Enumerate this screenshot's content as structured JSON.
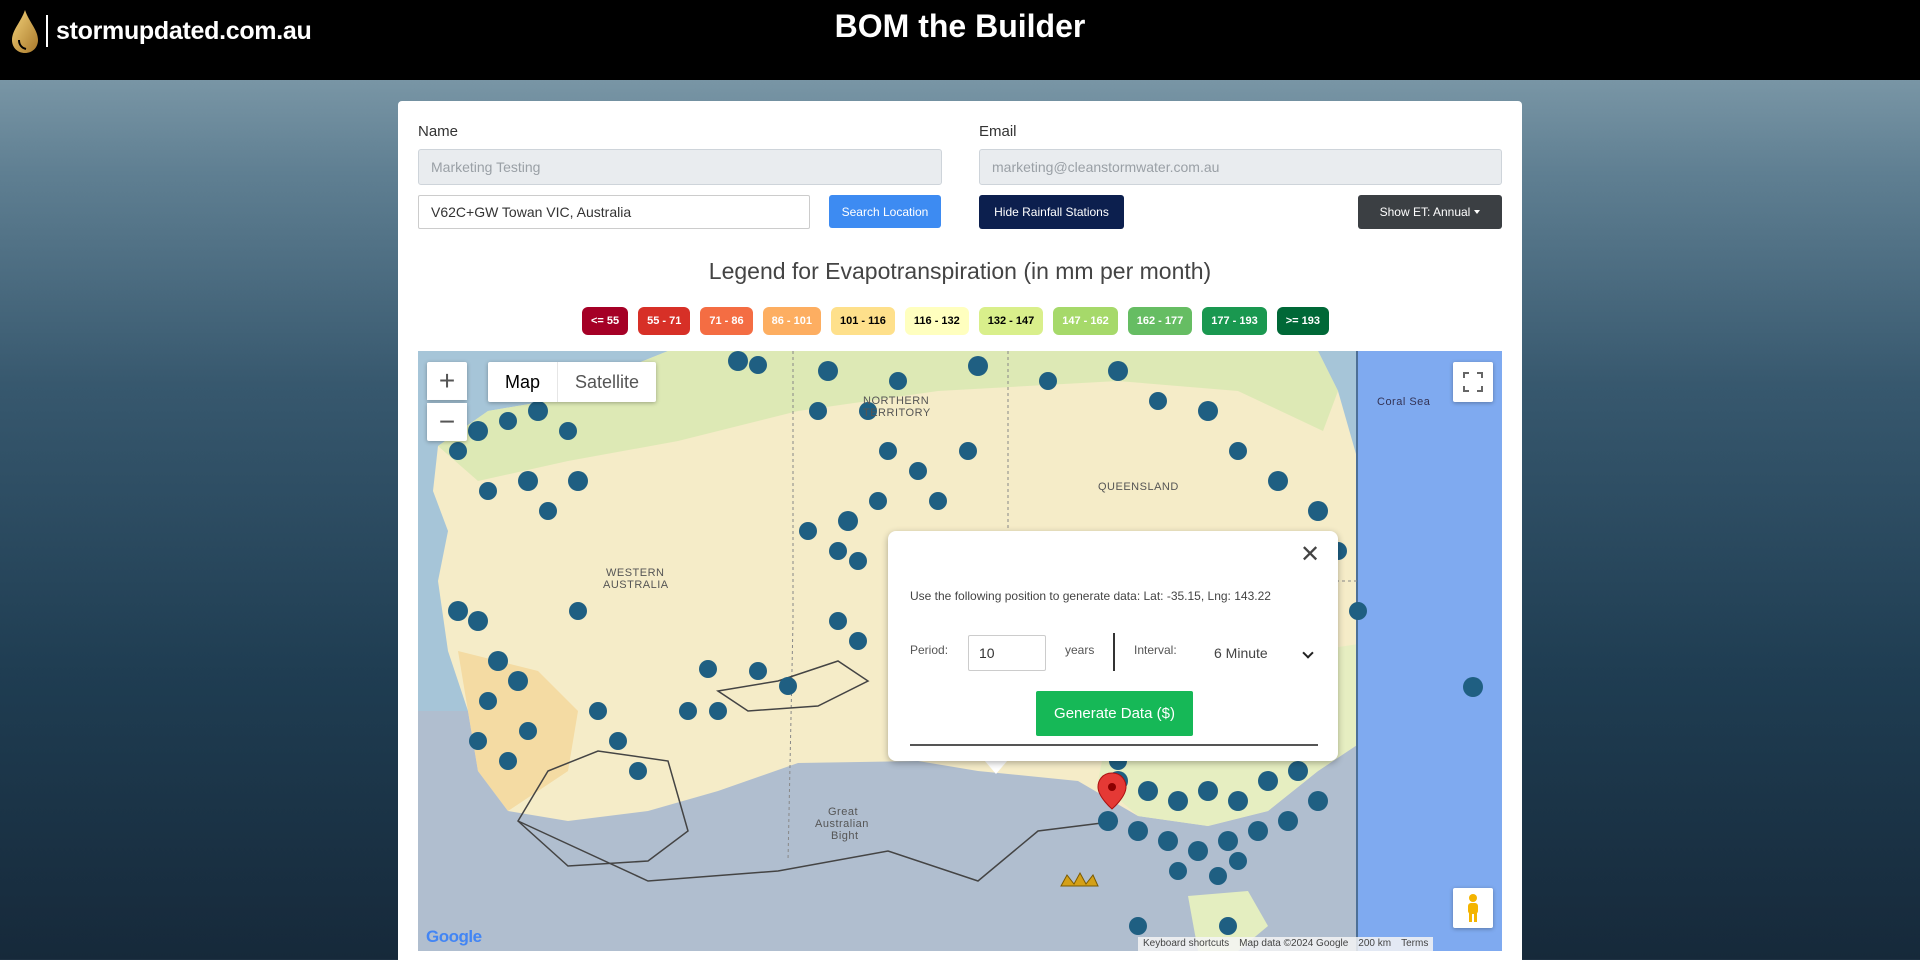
{
  "header": {
    "site_name": "stormupdated.com.au",
    "title": "BOM the Builder"
  },
  "form": {
    "name_label": "Name",
    "name_value": "Marketing Testing",
    "email_label": "Email",
    "email_value": "marketing@cleanstormwater.com.au",
    "location_value": "V62C+GW Towan VIC, Australia",
    "search_button": "Search Location",
    "hide_stations_button": "Hide Rainfall Stations",
    "show_et_button": "Show ET: Annual"
  },
  "legend": {
    "title": "Legend for Evapotranspiration (in mm per month)",
    "items": [
      {
        "label": "<= 55",
        "color": "#a50026",
        "text": "#ffffff"
      },
      {
        "label": "55 - 71",
        "color": "#d73027",
        "text": "#ffffff"
      },
      {
        "label": "71 - 86",
        "color": "#f46d43",
        "text": "#ffffff"
      },
      {
        "label": "86 - 101",
        "color": "#fdae61",
        "text": "#ffffff"
      },
      {
        "label": "101 - 116",
        "color": "#fee08b",
        "text": "#000000"
      },
      {
        "label": "116 - 132",
        "color": "#ffffbf",
        "text": "#000000"
      },
      {
        "label": "132 - 147",
        "color": "#d9ef8b",
        "text": "#000000"
      },
      {
        "label": "147 - 162",
        "color": "#a6d96a",
        "text": "#ffffff"
      },
      {
        "label": "162 - 177",
        "color": "#66bd63",
        "text": "#ffffff"
      },
      {
        "label": "177 - 193",
        "color": "#1a9850",
        "text": "#ffffff"
      },
      {
        "label": ">= 193",
        "color": "#006837",
        "text": "#ffffff"
      }
    ]
  },
  "map": {
    "map_type_map": "Map",
    "map_type_satellite": "Satellite",
    "labels": {
      "northern_territory_1": "NORTHERN",
      "northern_territory_2": "TERRITORY",
      "western_australia_1": "WESTERN",
      "western_australia_2": "AUSTRALIA",
      "queensland": "QUEENSLAND",
      "coral_sea": "Coral Sea",
      "great_bight_1": "Great",
      "great_bight_2": "Australian",
      "great_bight_3": "Bight"
    },
    "google_logo": "Google",
    "attribution": {
      "shortcuts": "Keyboard shortcuts",
      "data": "Map data ©2024 Google",
      "scale": "200 km",
      "terms": "Terms"
    }
  },
  "popup": {
    "message": "Use the following position to generate data: Lat: -35.15, Lng: 143.22",
    "period_label": "Period:",
    "period_value": "10",
    "years_label": "years",
    "interval_label": "Interval:",
    "interval_value": "6 Minute",
    "generate_button": "Generate Data ($)"
  }
}
